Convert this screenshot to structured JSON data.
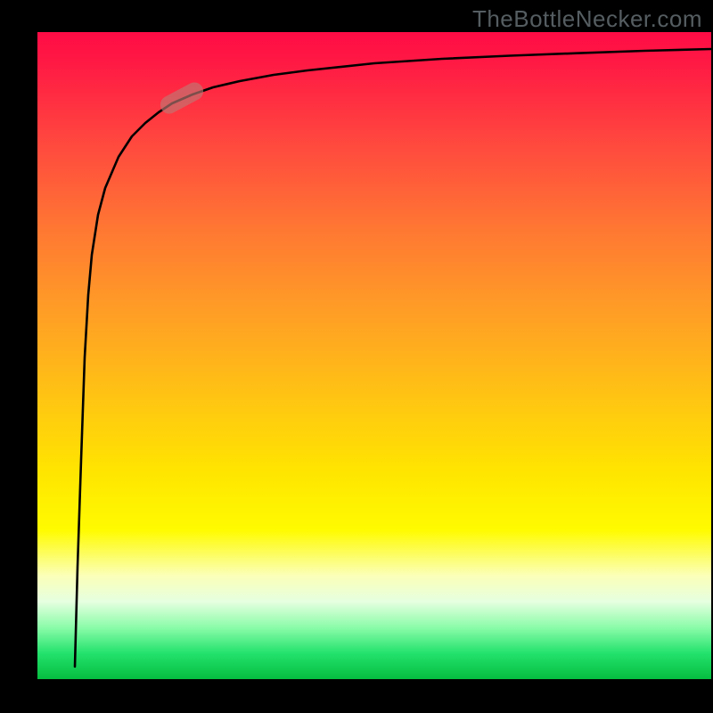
{
  "watermark": "TheBottleNecker.com",
  "colors": {
    "gradient_top": "#ff0b45",
    "gradient_mid": "#ffe500",
    "gradient_bottom": "#06bd3f",
    "curve": "#000000",
    "marker": "rgba(190,120,115,0.65)",
    "frame": "#000000"
  },
  "chart_data": {
    "type": "line",
    "title": "",
    "xlabel": "",
    "ylabel": "",
    "xlim": [
      0,
      100
    ],
    "ylim": [
      0,
      100
    ],
    "note": "Axis values are unlabeled in the source image; x/y are image-derived percentages (0–100).",
    "series": [
      {
        "name": "bottleneck-curve",
        "x": [
          5.5,
          6.0,
          6.5,
          7.0,
          7.5,
          8.0,
          9.0,
          10.0,
          12.0,
          14.0,
          16.0,
          18.0,
          20.0,
          23.0,
          26.0,
          30.0,
          35.0,
          40.0,
          50.0,
          60.0,
          70.0,
          80.0,
          90.0,
          100.0
        ],
        "y": [
          2.0,
          15.0,
          30.0,
          45.0,
          55.0,
          62.0,
          70.0,
          75.0,
          80.0,
          83.0,
          85.2,
          87.0,
          88.3,
          89.8,
          90.8,
          91.8,
          92.8,
          93.5,
          94.5,
          95.2,
          95.7,
          96.1,
          96.5,
          96.7
        ]
      }
    ],
    "marker": {
      "xy": [
        22.0,
        89.5
      ],
      "label": ""
    }
  }
}
